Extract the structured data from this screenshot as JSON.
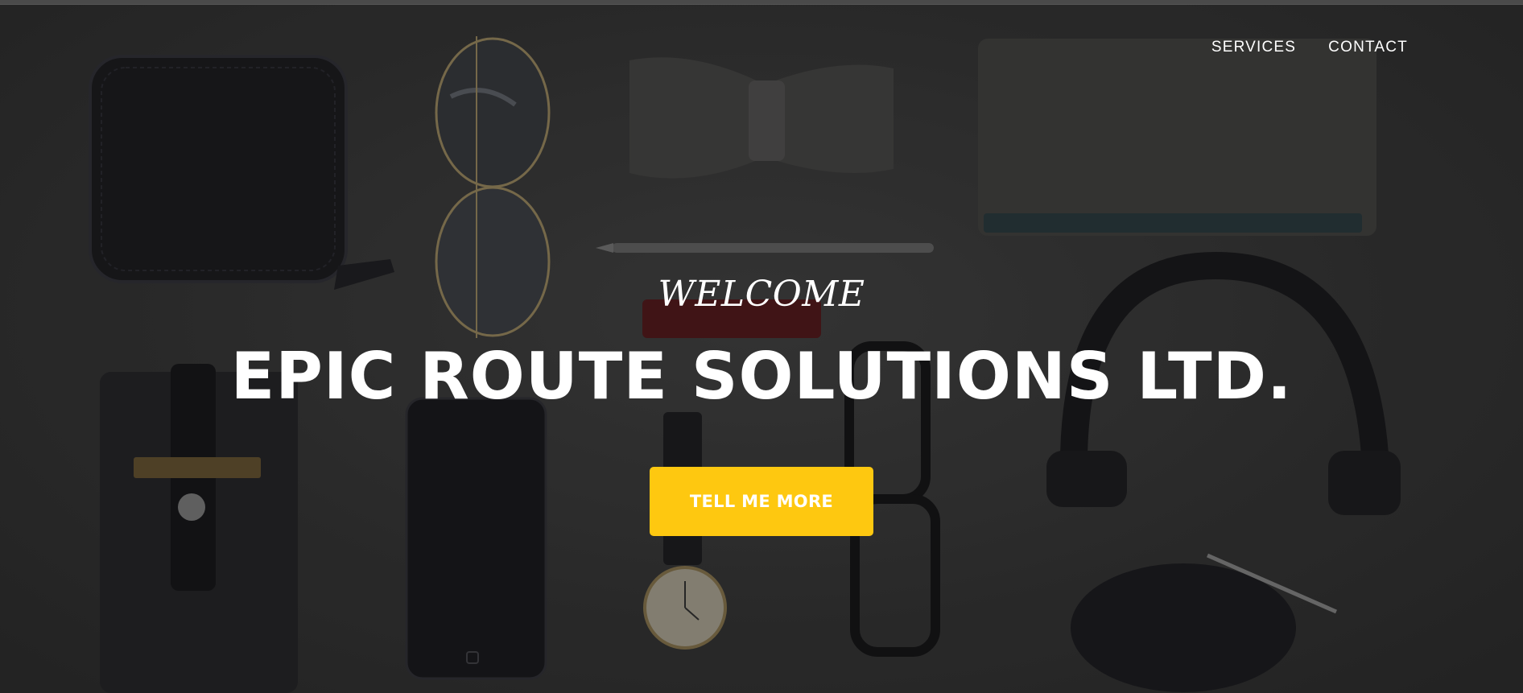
{
  "nav": {
    "items": [
      {
        "label": "SERVICES"
      },
      {
        "label": "CONTACT"
      }
    ]
  },
  "hero": {
    "subheading": "WELCOME",
    "heading": "EPIC ROUTE SOLUTIONS LTD.",
    "cta_label": "TELL ME MORE",
    "background": "flat-lay photo of accessories (wallet, sunglasses, bow tie, pen, notebook, phone case, phone, watch, glasses, headphones)"
  },
  "colors": {
    "accent": "#fec810",
    "text": "#ffffff",
    "background": "#2c2c2c"
  }
}
